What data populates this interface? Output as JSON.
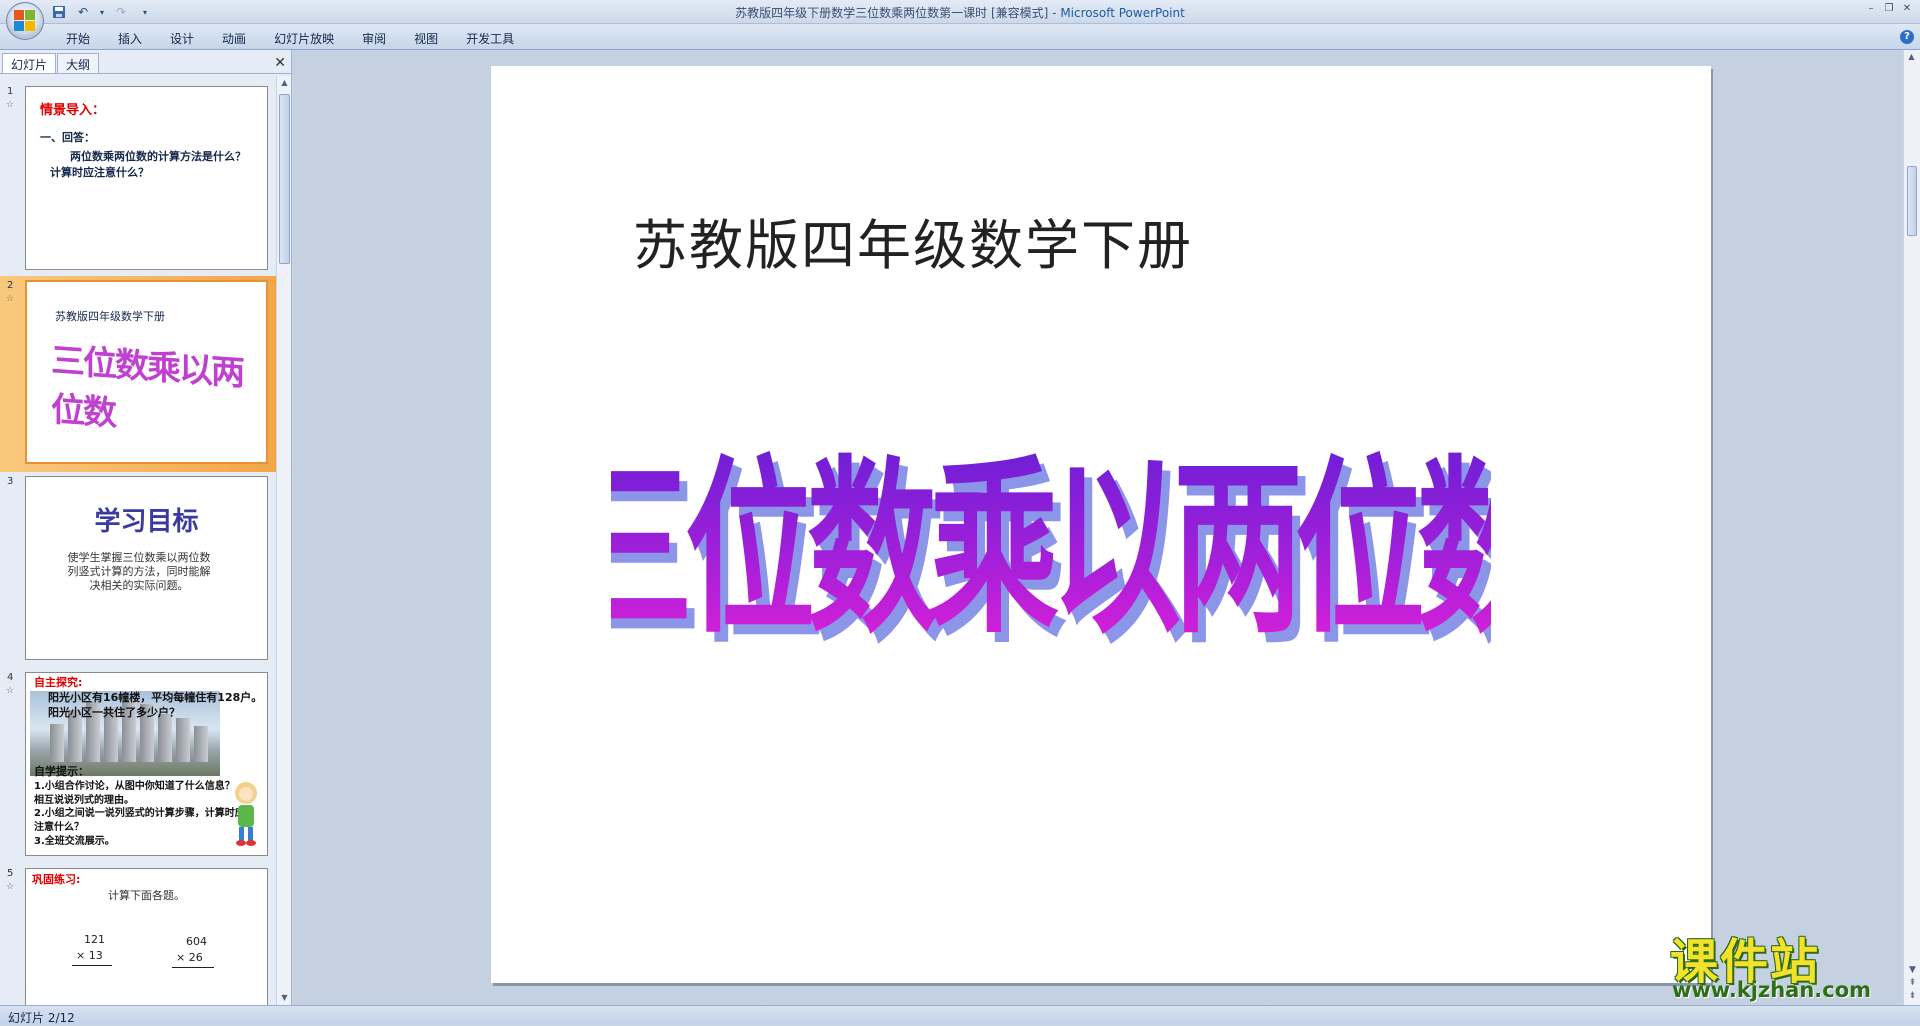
{
  "window": {
    "title_doc": "苏教版四年级下册数学三位数乘两位数第一课时 [兼容模式]",
    "title_sep": " - ",
    "title_app": "Microsoft PowerPoint"
  },
  "ribbon": {
    "tabs": [
      "开始",
      "插入",
      "设计",
      "动画",
      "幻灯片放映",
      "审阅",
      "视图",
      "开发工具"
    ]
  },
  "left_panel": {
    "tabs": [
      "幻灯片",
      "大纲"
    ],
    "slides": [
      {
        "num": "1",
        "heading": "情景导入：",
        "sub": "一、回答：",
        "body": "两位数乘两位数的计算方法是什么？计算时应注意什么？"
      },
      {
        "num": "2",
        "top": "苏教版四年级数学下册",
        "art": "三位数乘以两位数"
      },
      {
        "num": "3",
        "heading": "学习目标",
        "body": "使学生掌握三位数乘以两位数列竖式计算的方法，同时能解决相关的实际问题。"
      },
      {
        "num": "4",
        "heading": "自主探究:",
        "line1": "阳光小区有16幢楼，平均每幢住有128户。",
        "line2": "阳光小区一共住了多少户？",
        "group_head": "自学提示：",
        "tip1": "1.小组合作讨论，从图中你知道了什么信息？",
        "tip1b": "相互说说列式的理由。",
        "tip2": "2.小组之间说一说列竖式的计算步骤，计算时应",
        "tip2b": "注意什么？",
        "tip3": "3.全班交流展示。"
      },
      {
        "num": "5",
        "heading": "巩固练习:",
        "sub": "计算下面各题。",
        "a_top": "121",
        "a_bottom": "× 13",
        "b_top": "604",
        "b_bottom": "× 26"
      }
    ]
  },
  "slide": {
    "subtitle": "苏教版四年级数学下册",
    "wordart": "三位数乘以两位数"
  },
  "status": {
    "slide_info": "幻灯片 2/12"
  },
  "watermark": {
    "title": "课件站",
    "url": "www.kjzhan.com"
  }
}
